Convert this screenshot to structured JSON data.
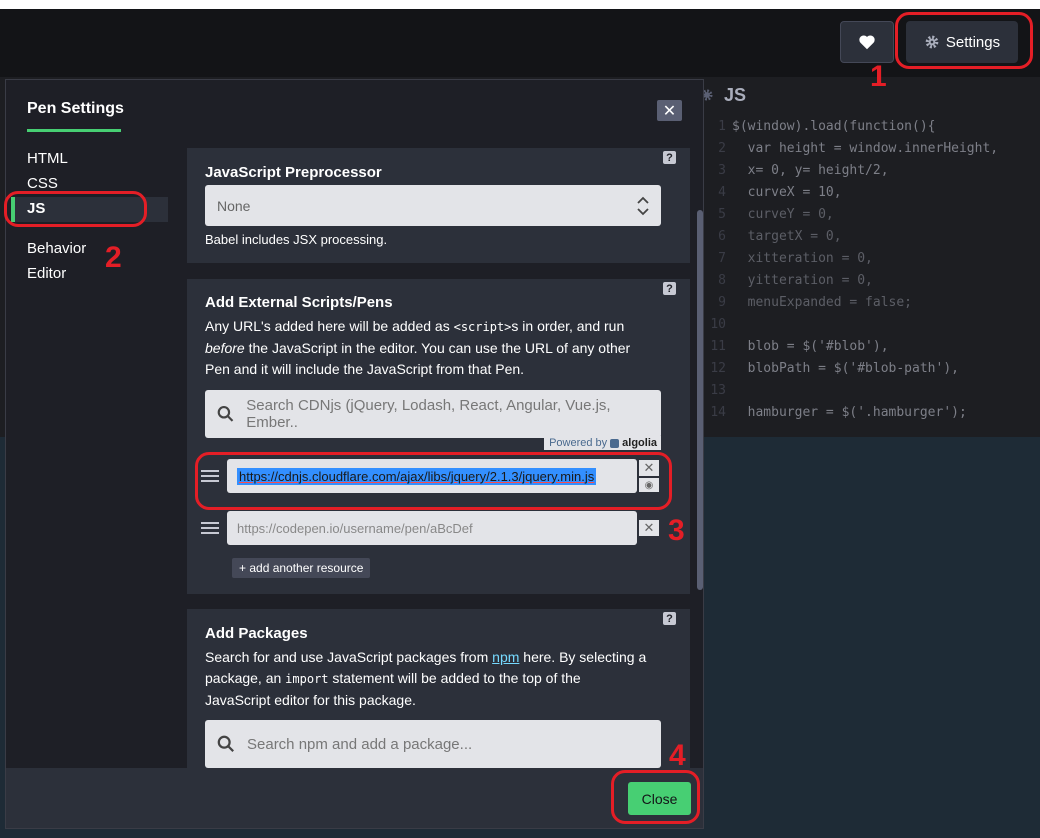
{
  "toolbar": {
    "settings_label": "Settings"
  },
  "js_panel": {
    "title": "JS",
    "code_lines": [
      {
        "num": "1",
        "text": "$(window).load(function(){"
      },
      {
        "num": "2",
        "text": "  var height = window.innerHeight,"
      },
      {
        "num": "3",
        "text": "  x= 0, y= height/2,"
      },
      {
        "num": "4",
        "text": "  curveX = 10,"
      },
      {
        "num": "5",
        "text": "  curveY = 0,"
      },
      {
        "num": "6",
        "text": "  targetX = 0,"
      },
      {
        "num": "7",
        "text": "  xitteration = 0,"
      },
      {
        "num": "8",
        "text": "  yitteration = 0,"
      },
      {
        "num": "9",
        "text": "  menuExpanded = false;"
      },
      {
        "num": "10",
        "text": ""
      },
      {
        "num": "11",
        "text": "  blob = $('#blob'),"
      },
      {
        "num": "12",
        "text": "  blobPath = $('#blob-path'),"
      },
      {
        "num": "13",
        "text": ""
      },
      {
        "num": "14",
        "text": "  hamburger = $('.hamburger');"
      }
    ]
  },
  "annotations": [
    "1",
    "2",
    "3",
    "4"
  ],
  "modal": {
    "title": "Pen Settings",
    "close_symbol": "✕",
    "nav": [
      "HTML",
      "CSS",
      "JS",
      "Behavior",
      "Editor"
    ],
    "preprocessor": {
      "title": "JavaScript Preprocessor",
      "selected": "None",
      "note": "Babel includes JSX processing.",
      "help": "?"
    },
    "external": {
      "title": "Add External Scripts/Pens",
      "desc_1": "Any URL's added here will be added as ",
      "desc_code": "<script>",
      "desc_2": "s in order, and run",
      "desc_em": "before",
      "desc_3": " the JavaScript in the editor. You can use the URL of any other",
      "desc_4": "Pen and it will include the JavaScript from that Pen.",
      "search_placeholder": "Search CDNjs (jQuery, Lodash, React, Angular, Vue.js, Ember..",
      "powered_by": "Powered by",
      "algolia": "algolia",
      "resource_1": "https://cdnjs.cloudflare.com/ajax/libs/jquery/2.1.3/jquery.min.js",
      "resource_2_placeholder": "https://codepen.io/username/pen/aBcDef",
      "add_resource": "+ add another resource",
      "help": "?"
    },
    "packages": {
      "title": "Add Packages",
      "desc_1": "Search for and use JavaScript packages from ",
      "desc_link": "npm",
      "desc_2": " here. By selecting a",
      "desc_3a": "package, an ",
      "desc_code": "import",
      "desc_3b": " statement will be added to the top of the",
      "desc_4": "JavaScript editor for this package.",
      "search_placeholder": "Search npm and add a package...",
      "help": "?"
    },
    "close_label": "Close"
  },
  "colors": {
    "accent_green": "#47cf73",
    "annotation_red": "#e41e26",
    "selection_blue": "#338fff"
  }
}
